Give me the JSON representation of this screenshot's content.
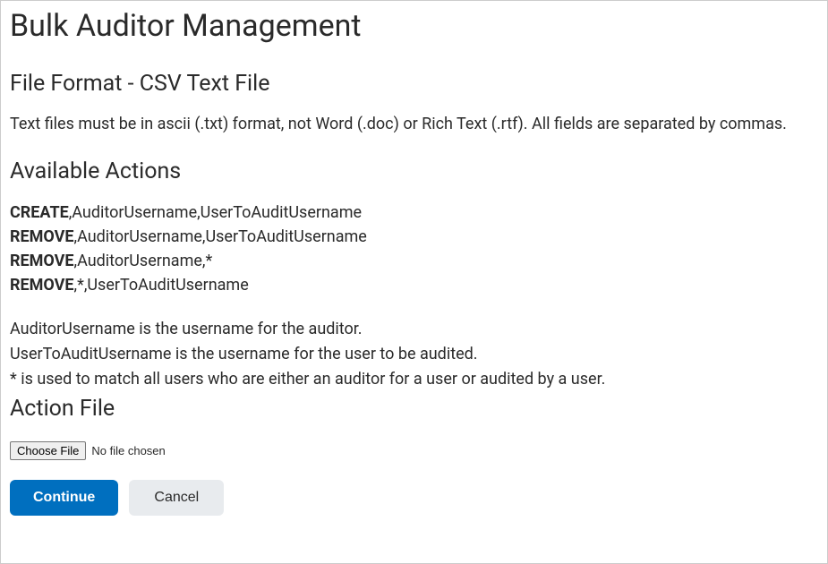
{
  "page_title": "Bulk Auditor Management",
  "file_format": {
    "heading": "File Format - CSV Text File",
    "description": "Text files must be in ascii (.txt) format, not Word (.doc) or Rich Text (.rtf). All fields are separated by commas."
  },
  "available_actions": {
    "heading": "Available Actions",
    "rows": [
      {
        "cmd": "CREATE",
        "rest": ",AuditorUsername,UserToAuditUsername"
      },
      {
        "cmd": "REMOVE",
        "rest": ",AuditorUsername,UserToAuditUsername"
      },
      {
        "cmd": "REMOVE",
        "rest": ",AuditorUsername,*"
      },
      {
        "cmd": "REMOVE",
        "rest": ",*,UserToAuditUsername"
      }
    ],
    "explanations": [
      "AuditorUsername is the username for the auditor.",
      "UserToAuditUsername is the username for the user to be audited.",
      "* is used to match all users who are either an auditor for a user or audited by a user."
    ]
  },
  "action_file": {
    "heading": "Action File",
    "choose_label": "Choose File",
    "status": "No file chosen"
  },
  "buttons": {
    "continue": "Continue",
    "cancel": "Cancel"
  }
}
